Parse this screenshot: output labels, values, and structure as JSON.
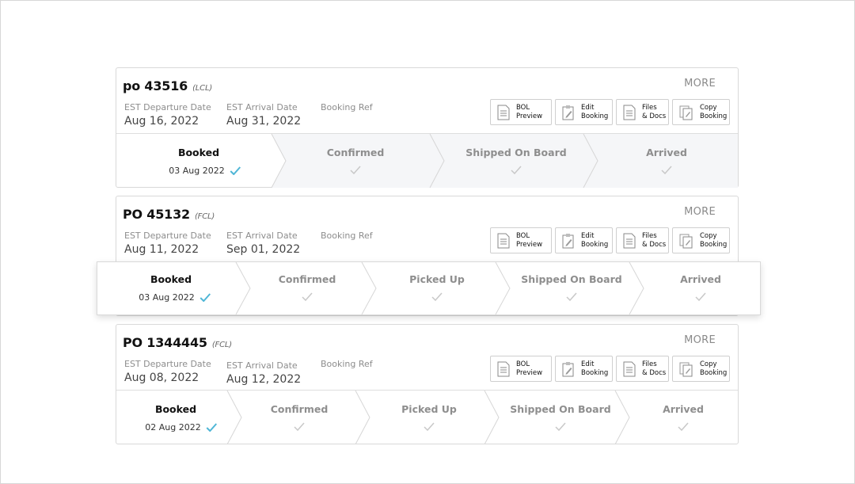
{
  "common": {
    "more_label": "MORE",
    "departure_label": "EST Departure Date",
    "arrival_label": "EST Arrival Date",
    "booking_ref_label": "Booking Ref",
    "actions": {
      "bol": "BOL\nPreview",
      "edit": "Edit\nBooking",
      "files": "Files\n& Docs",
      "copy": "Copy\nBooking"
    }
  },
  "colors": {
    "check_done": "#4fb6d6",
    "check_pending": "#c8c8c8",
    "step_pending_bg": "#f5f6f8"
  },
  "shipments": [
    {
      "po": "po 43516",
      "type": "(LCL)",
      "departure": "Aug 16, 2022",
      "arrival": "Aug 31, 2022",
      "booking_ref": "",
      "steps": [
        {
          "label": "Booked",
          "date": "03 Aug 2022",
          "done": true
        },
        {
          "label": "Confirmed",
          "done": false
        },
        {
          "label": "Shipped On Board",
          "done": false
        },
        {
          "label": "Arrived",
          "done": false
        }
      ]
    },
    {
      "po": "PO 45132",
      "type": "(FCL)",
      "departure": "Aug 11, 2022",
      "arrival": "Sep 01, 2022",
      "booking_ref": "",
      "steps": [
        {
          "label": "Booked",
          "date": "03 Aug 2022",
          "done": true
        },
        {
          "label": "Confirmed",
          "done": false
        },
        {
          "label": "Picked Up",
          "done": false
        },
        {
          "label": "Shipped On Board",
          "done": false
        },
        {
          "label": "Arrived",
          "done": false
        }
      ]
    },
    {
      "po": "PO 1344445",
      "type": "(FCL)",
      "departure": "Aug 08, 2022",
      "arrival": "Aug 12, 2022",
      "booking_ref": "",
      "steps": [
        {
          "label": "Booked",
          "date": "02 Aug 2022",
          "done": true
        },
        {
          "label": "Confirmed",
          "done": false
        },
        {
          "label": "Picked Up",
          "done": false
        },
        {
          "label": "Shipped On Board",
          "done": false
        },
        {
          "label": "Arrived",
          "done": false
        }
      ]
    }
  ]
}
